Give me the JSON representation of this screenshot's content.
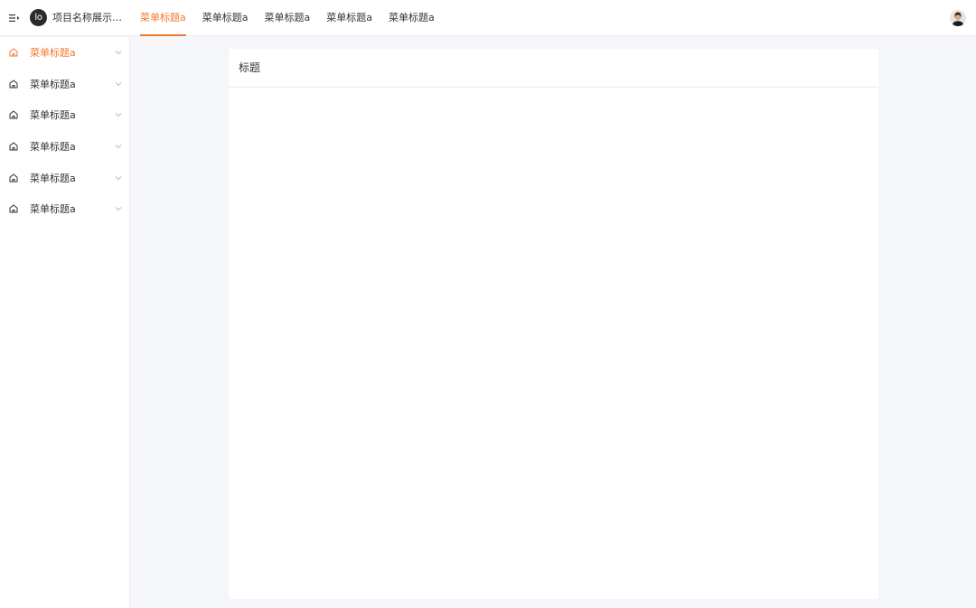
{
  "header": {
    "logo_text": "lo",
    "project_name": "项目名称展示区域",
    "nav_items": [
      {
        "label": "菜单标题a"
      },
      {
        "label": "菜单标题a"
      },
      {
        "label": "菜单标题a"
      },
      {
        "label": "菜单标题a"
      },
      {
        "label": "菜单标题a"
      }
    ],
    "active_nav_index": 0
  },
  "sidebar": {
    "items": [
      {
        "label": "菜单标题a",
        "icon": "home-icon"
      },
      {
        "label": "菜单标题a",
        "icon": "home-icon"
      },
      {
        "label": "菜单标题a",
        "icon": "home-icon"
      },
      {
        "label": "菜单标题a",
        "icon": "home-icon"
      },
      {
        "label": "菜单标题a",
        "icon": "home-icon"
      },
      {
        "label": "菜单标题a",
        "icon": "home-icon"
      }
    ],
    "active_index": 0
  },
  "main": {
    "panel_title": "标题"
  },
  "colors": {
    "accent": "#f07a2f",
    "background": "#f5f6f9",
    "surface": "#ffffff",
    "border": "#ececec"
  }
}
